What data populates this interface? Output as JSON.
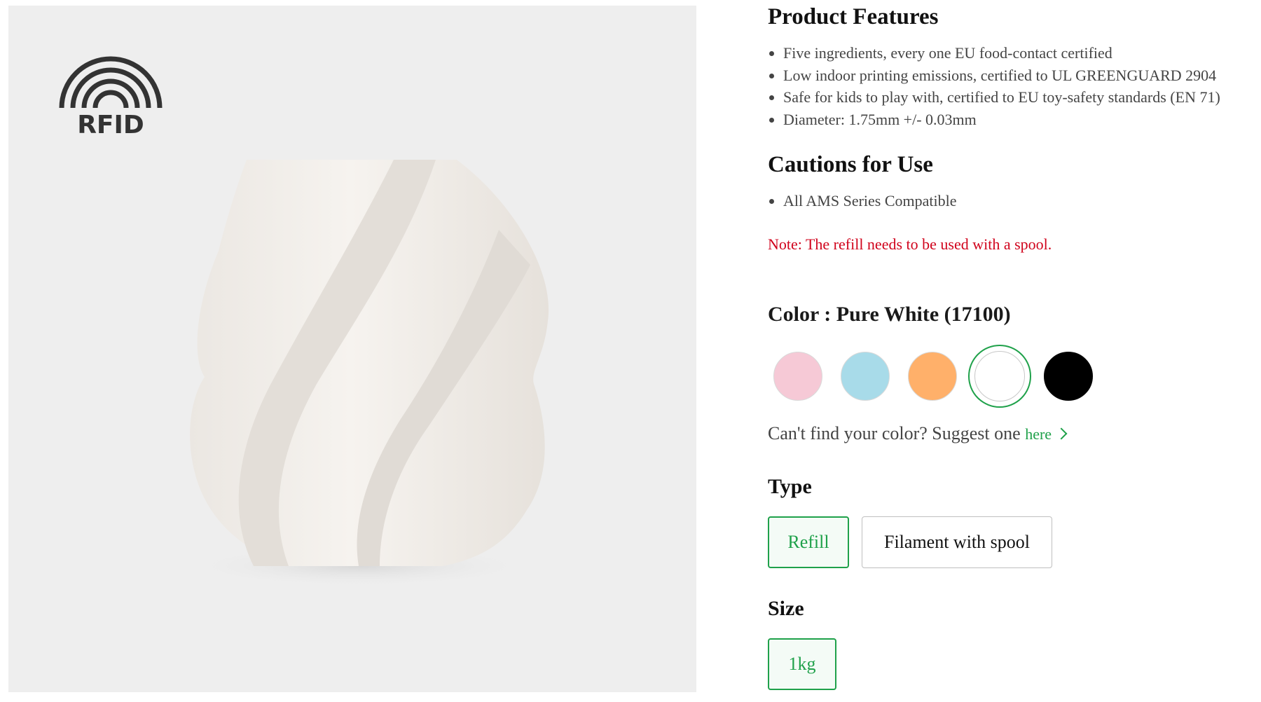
{
  "media": {
    "logo_text": "RFID"
  },
  "features": {
    "title": "Product Features",
    "items": [
      "Five ingredients, every one EU food-contact certified",
      "Low indoor printing emissions, certified to UL GREENGUARD 2904",
      "Safe for kids to play with, certified to EU toy-safety standards (EN 71)",
      "Diameter: 1.75mm +/- 0.03mm"
    ]
  },
  "cautions": {
    "title": "Cautions for Use",
    "items": [
      "All AMS Series Compatible"
    ]
  },
  "note": "Note: The refill needs to be used with a spool.",
  "color": {
    "heading": "Color : Pure White (17100)",
    "swatches": [
      {
        "color": "#f6c9d6"
      },
      {
        "color": "#a8dbe9"
      },
      {
        "color": "#ffb06a"
      },
      {
        "color": "#ffffff",
        "selected": true
      },
      {
        "color": "#000000"
      }
    ],
    "suggest_text": "Can't find your color? Suggest one ",
    "suggest_link": "here"
  },
  "type": {
    "title": "Type",
    "options": [
      "Refill",
      "Filament with spool"
    ],
    "selected": "Refill"
  },
  "size": {
    "title": "Size",
    "options": [
      "1kg"
    ],
    "selected": "1kg"
  },
  "accent_color": "#1fa14a",
  "note_color": "#d0021b"
}
